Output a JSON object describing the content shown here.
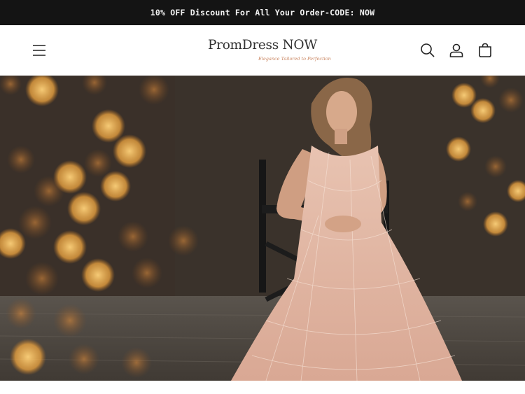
{
  "announcement": {
    "text": "10% OFF Discount For All Your Order-CODE: NOW"
  },
  "header": {
    "menu_icon": "hamburger-menu-icon",
    "logo_text": "PromDress NOW",
    "logo_tagline": "Elegance Tailored to Perfection",
    "icons": [
      "search-icon",
      "account-icon",
      "cart-icon"
    ]
  },
  "hero": {
    "image": "model-in-lace-gown-seated-on-chair-with-bokeh-lights"
  },
  "colors": {
    "announcement_bg": "#141414",
    "announcement_text": "#f3f3f3",
    "tagline": "#c9845f",
    "header_bg": "#ffffff"
  }
}
